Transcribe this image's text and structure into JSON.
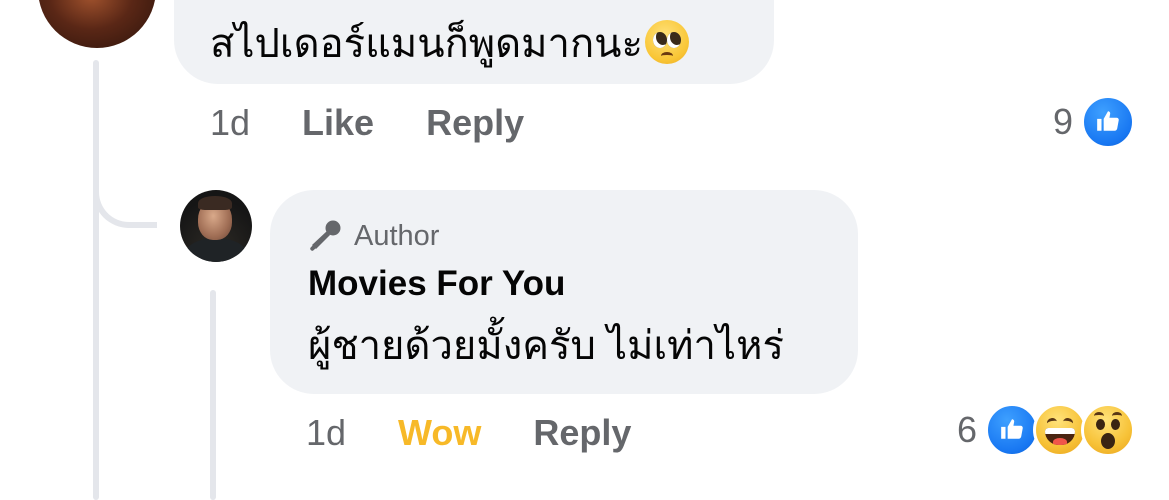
{
  "thread": {
    "parent_comment": {
      "text": "สไปเดอร์แมนก็พูดมากนะ",
      "emoji": "pleading-face-emoji",
      "time": "1d",
      "like_label": "Like",
      "reply_label": "Reply",
      "reaction_count": "9",
      "reactions": [
        "like-icon"
      ]
    },
    "reply_comment": {
      "badge": "Author",
      "badge_icon": "microphone-icon",
      "author_name": "Movies For You",
      "text": "ผู้ชายด้วยมั้งครับ ไม่เท่าไหร่",
      "time": "1d",
      "reaction_label": "Wow",
      "reply_label": "Reply",
      "reaction_count": "6",
      "reactions": [
        "like-icon",
        "haha-icon",
        "wow-icon"
      ]
    }
  },
  "colors": {
    "bubble_bg": "#f0f2f5",
    "secondary_text": "#65676b",
    "wow_active": "#f7b928",
    "like_blue": "#1877f2",
    "thread_line": "#e4e6eb"
  }
}
